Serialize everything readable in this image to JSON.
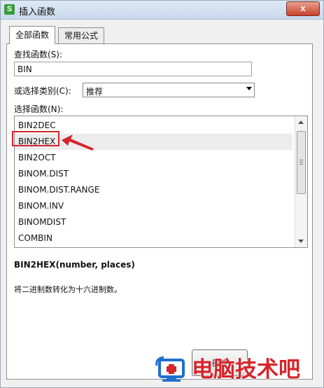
{
  "window": {
    "title": "插入函数",
    "app_icon_letter": "S",
    "close_glyph": "x"
  },
  "tabs": [
    {
      "label": "全部函数",
      "active": true
    },
    {
      "label": "常用公式",
      "active": false
    }
  ],
  "search": {
    "label": "查找函数(S):",
    "value": "BIN"
  },
  "category": {
    "label": "或选择类别(C):",
    "selected": "推荐"
  },
  "function_list": {
    "label": "选择函数(N):",
    "items": [
      "BIN2DEC",
      "BIN2HEX",
      "BIN2OCT",
      "BINOM.DIST",
      "BINOM.DIST.RANGE",
      "BINOM.INV",
      "BINOMDIST",
      "COMBIN"
    ],
    "selected_index": 1
  },
  "details": {
    "signature": "BIN2HEX(number, places)",
    "description": "将二进制数转化为十六进制数。"
  },
  "buttons": {
    "ok_label": "确定"
  },
  "watermark": {
    "text": "电脑技术吧"
  },
  "colors": {
    "annotation_red": "#d6242b",
    "selection_bg": "#ececec",
    "logo_blue": "#1e6fd0"
  }
}
